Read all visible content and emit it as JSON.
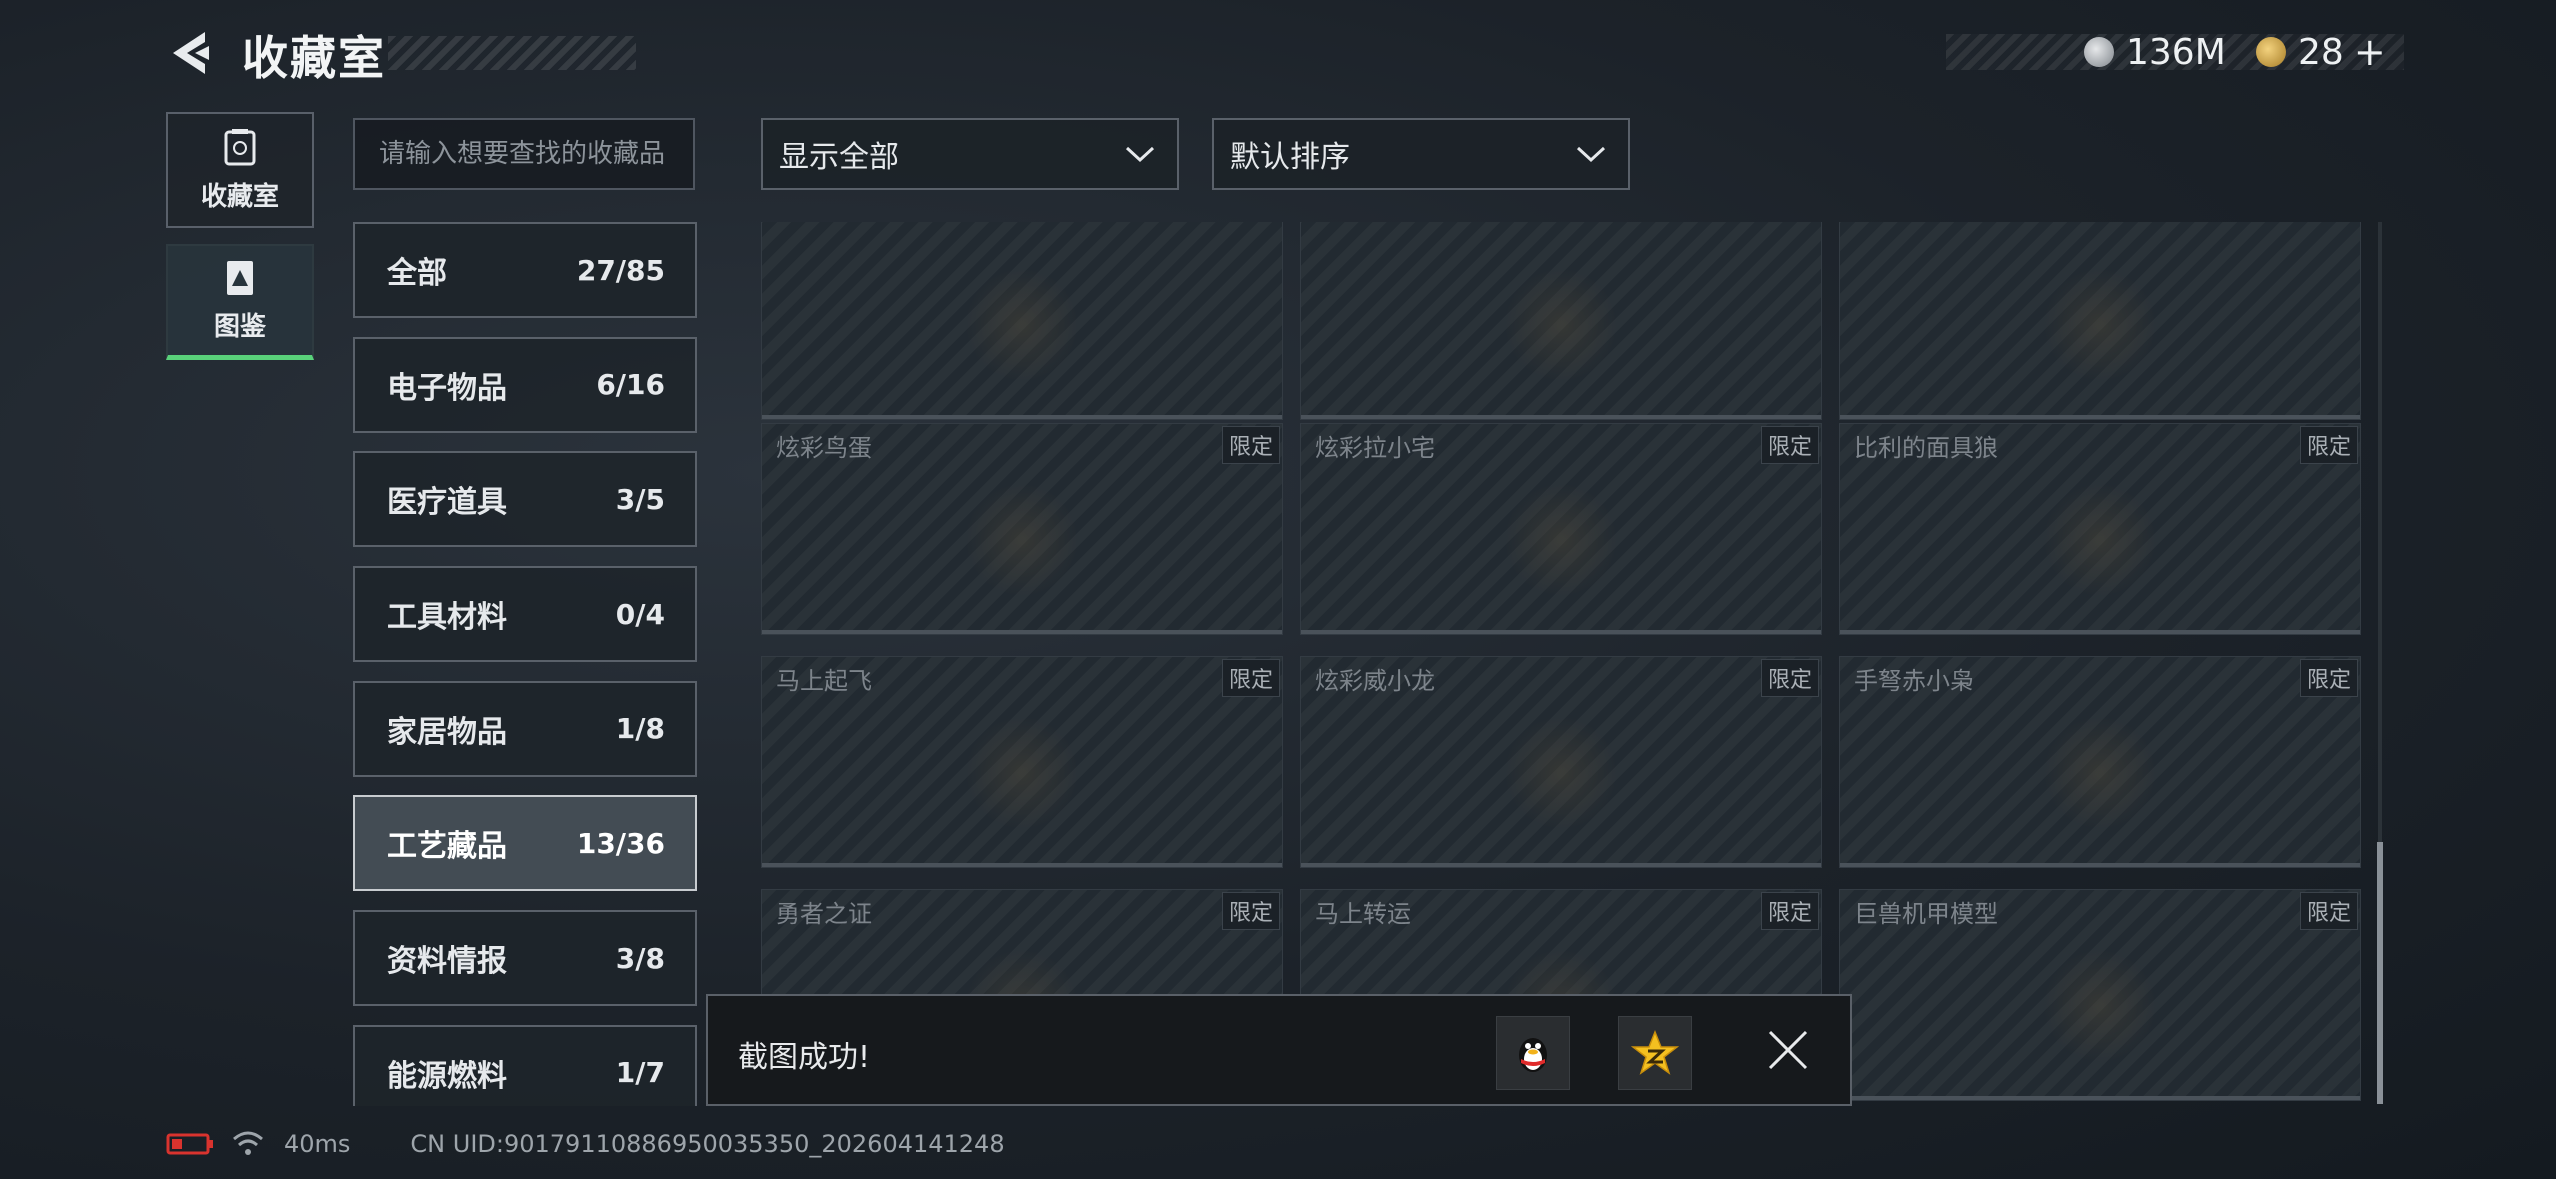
{
  "header": {
    "title": "收藏室",
    "currencies": [
      {
        "icon": "silver-coin-icon",
        "value": "136M"
      },
      {
        "icon": "gold-coin-icon",
        "value": "28"
      }
    ],
    "plus_label": "+"
  },
  "nav": {
    "items": [
      {
        "label": "收藏室",
        "icon": "collection-room-icon",
        "active": false
      },
      {
        "label": "图鉴",
        "icon": "codex-icon",
        "active": true
      }
    ]
  },
  "search": {
    "placeholder": "请输入想要查找的收藏品"
  },
  "filters": {
    "display": "显示全部",
    "sort": "默认排序"
  },
  "categories": [
    {
      "label": "全部",
      "count": "27/85"
    },
    {
      "label": "电子物品",
      "count": "6/16"
    },
    {
      "label": "医疗道具",
      "count": "3/5"
    },
    {
      "label": "工具材料",
      "count": "0/4"
    },
    {
      "label": "家居物品",
      "count": "1/8"
    },
    {
      "label": "工艺藏品",
      "count": "13/36",
      "active": true
    },
    {
      "label": "资料情报",
      "count": "3/8"
    },
    {
      "label": "能源燃料",
      "count": "1/7"
    }
  ],
  "items": [
    {
      "name": "",
      "tag": ""
    },
    {
      "name": "",
      "tag": ""
    },
    {
      "name": "",
      "tag": ""
    },
    {
      "name": "炫彩鸟蛋",
      "tag": "限定"
    },
    {
      "name": "炫彩拉小宅",
      "tag": "限定"
    },
    {
      "name": "比利的面具狼",
      "tag": "限定"
    },
    {
      "name": "马上起飞",
      "tag": "限定"
    },
    {
      "name": "炫彩威小龙",
      "tag": "限定"
    },
    {
      "name": "手弩赤小枭",
      "tag": "限定"
    },
    {
      "name": "勇者之证",
      "tag": "限定"
    },
    {
      "name": "马上转运",
      "tag": "限定"
    },
    {
      "name": "巨兽机甲模型",
      "tag": "限定"
    }
  ],
  "toast": {
    "message": "截图成功!"
  },
  "status_bar": {
    "ping": "40ms",
    "uid": "CN UID:9017911088695003535​0_202604141248"
  },
  "colors": {
    "accent_green": "#59d27a",
    "battery_red": "#d9332e"
  }
}
